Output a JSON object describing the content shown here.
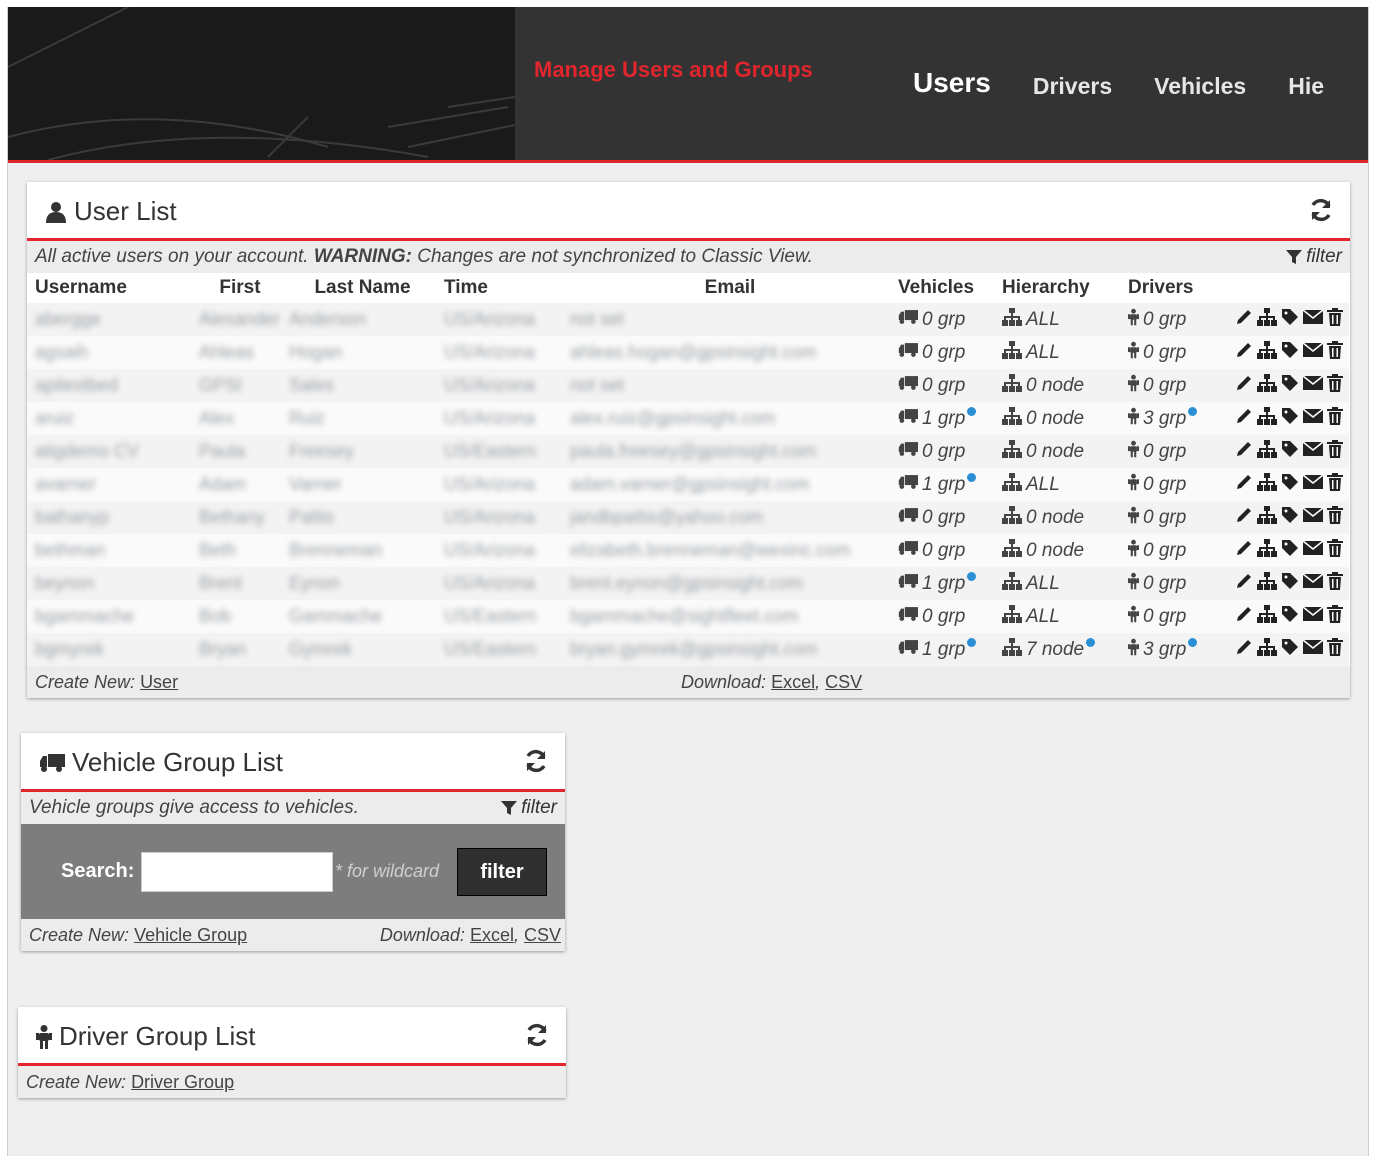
{
  "header": {
    "app_title": "Manage Users and Groups",
    "tabs": [
      "Users",
      "Drivers",
      "Vehicles",
      "Hie"
    ],
    "active_tab": "Users"
  },
  "user_list": {
    "title": "User List",
    "description_pre": "All active users on your account.",
    "description_warning": "WARNING:",
    "description_post": " Changes are not synchronized to Classic View.",
    "filter_label": "filter",
    "columns": [
      "Username",
      "First",
      "Last Name",
      "Time",
      "Email",
      "Vehicles",
      "Hierarchy",
      "Drivers"
    ],
    "rows": [
      {
        "username": "abergge",
        "first": "Alexander",
        "last": "Anderson",
        "time": "US/Arizona",
        "email": "not set",
        "vehicles": "0 grp",
        "vehicles_info": false,
        "hierarchy": "ALL",
        "hierarchy_info": false,
        "drivers": "0 grp",
        "drivers_info": false
      },
      {
        "username": "agsaih",
        "first": "Ahleas",
        "last": "Hogan",
        "time": "US/Arizona",
        "email": "ahleas.hogan@gpsinsight.com",
        "vehicles": "0 grp",
        "vehicles_info": false,
        "hierarchy": "ALL",
        "hierarchy_info": false,
        "drivers": "0 grp",
        "drivers_info": false
      },
      {
        "username": "apitestbed",
        "first": "GPSI",
        "last": "Sales",
        "time": "US/Arizona",
        "email": "not set",
        "vehicles": "0 grp",
        "vehicles_info": false,
        "hierarchy": "0 node",
        "hierarchy_info": false,
        "drivers": "0 grp",
        "drivers_info": false
      },
      {
        "username": "aruiz",
        "first": "Alex",
        "last": "Ruiz",
        "time": "US/Arizona",
        "email": "alex.ruiz@gpsinsight.com",
        "vehicles": "1 grp",
        "vehicles_info": true,
        "hierarchy": "0 node",
        "hierarchy_info": false,
        "drivers": "3 grp",
        "drivers_info": true
      },
      {
        "username": "atigdemo CV",
        "first": "Paula",
        "last": "Freesey",
        "time": "US/Eastern",
        "email": "paula.freesey@gpsinsight.com",
        "vehicles": "0 grp",
        "vehicles_info": false,
        "hierarchy": "0 node",
        "hierarchy_info": false,
        "drivers": "0 grp",
        "drivers_info": false
      },
      {
        "username": "avarner",
        "first": "Adam",
        "last": "Varner",
        "time": "US/Arizona",
        "email": "adam.varner@gpsinsight.com",
        "vehicles": "1 grp",
        "vehicles_info": true,
        "hierarchy": "ALL",
        "hierarchy_info": false,
        "drivers": "0 grp",
        "drivers_info": false
      },
      {
        "username": "bathanyp",
        "first": "Bethany",
        "last": "Pattis",
        "time": "US/Arizona",
        "email": "jandbpattis@yahoo.com",
        "vehicles": "0 grp",
        "vehicles_info": false,
        "hierarchy": "0 node",
        "hierarchy_info": false,
        "drivers": "0 grp",
        "drivers_info": false
      },
      {
        "username": "bethman",
        "first": "Beth",
        "last": "Brenneman",
        "time": "US/Arizona",
        "email": "elizabeth.brenneman@wexinc.com",
        "vehicles": "0 grp",
        "vehicles_info": false,
        "hierarchy": "0 node",
        "hierarchy_info": false,
        "drivers": "0 grp",
        "drivers_info": false
      },
      {
        "username": "beynon",
        "first": "Brent",
        "last": "Eynon",
        "time": "US/Arizona",
        "email": "brent.eynon@gpsinsight.com",
        "vehicles": "1 grp",
        "vehicles_info": true,
        "hierarchy": "ALL",
        "hierarchy_info": false,
        "drivers": "0 grp",
        "drivers_info": false
      },
      {
        "username": "bgammache",
        "first": "Bob",
        "last": "Gammache",
        "time": "US/Eastern",
        "email": "bgammache@sightfleet.com",
        "vehicles": "0 grp",
        "vehicles_info": false,
        "hierarchy": "ALL",
        "hierarchy_info": false,
        "drivers": "0 grp",
        "drivers_info": false
      },
      {
        "username": "bgmyrek",
        "first": "Bryan",
        "last": "Gymrek",
        "time": "US/Eastern",
        "email": "bryan.gymrek@gpsinsight.com",
        "vehicles": "1 grp",
        "vehicles_info": true,
        "hierarchy": "7 node",
        "hierarchy_info": true,
        "drivers": "3 grp",
        "drivers_info": true
      }
    ],
    "footer": {
      "create_label": "Create New:",
      "create_link": "User",
      "download_label": "Download:",
      "excel": "Excel",
      "sep": ",",
      "csv": "CSV"
    }
  },
  "vehicle_group_list": {
    "title": "Vehicle Group List",
    "description": "Vehicle groups give access to vehicles.",
    "filter_label": "filter",
    "search_label": "Search:",
    "search_value": "",
    "wildcard_hint": "* for wildcard",
    "filter_button": "filter",
    "footer": {
      "create_label": "Create New:",
      "create_link": "Vehicle Group",
      "download_label": "Download:",
      "excel": "Excel",
      "sep": ",",
      "csv": "CSV"
    }
  },
  "driver_group_list": {
    "title": "Driver Group List",
    "footer": {
      "create_label": "Create New:",
      "create_link": "Driver Group"
    }
  },
  "colors": {
    "accent_red": "#e0252c",
    "header_bg": "#333333",
    "info_blue": "#2b8fd6"
  }
}
